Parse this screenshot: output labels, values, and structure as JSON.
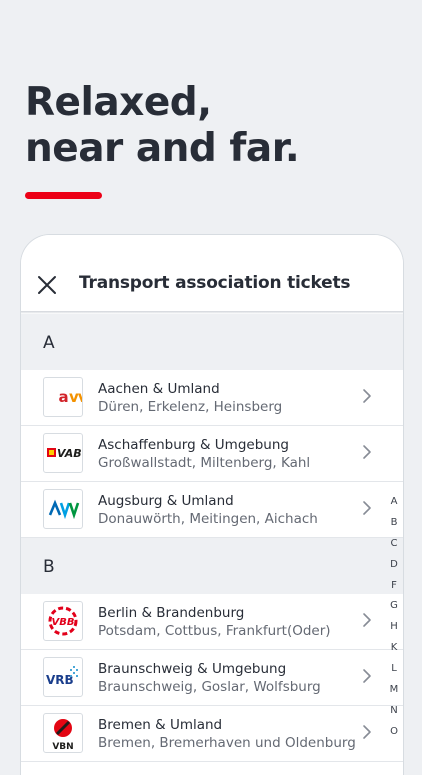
{
  "promo": {
    "headline_line1": "Relaxed,",
    "headline_line2": "near and far.",
    "accent_color": "#ec0016"
  },
  "screen": {
    "title": "Transport association tickets",
    "close_icon": "close-icon"
  },
  "sections": [
    {
      "letter": "A",
      "items": [
        {
          "title": "Aachen & Umland",
          "subtitle": "Düren, Erkelenz, Heinsberg",
          "logo": "AVV"
        },
        {
          "title": "Aschaffenburg & Umgebung",
          "subtitle": "Großwallstadt, Miltenberg, Kahl",
          "logo": "VAB"
        },
        {
          "title": "Augsburg & Umland",
          "subtitle": "Donauwörth, Meitingen, Aichach",
          "logo": "AVV"
        }
      ]
    },
    {
      "letter": "B",
      "items": [
        {
          "title": "Berlin & Brandenburg",
          "subtitle": "Potsdam, Cottbus, Frankfurt(Oder)",
          "logo": "VBB"
        },
        {
          "title": "Braunschweig & Umgebung",
          "subtitle": "Braunschweig, Goslar, Wolfsburg",
          "logo": "VRB"
        },
        {
          "title": "Bremen & Umland",
          "subtitle": "Bremen, Bremerhaven und Oldenburg",
          "logo": "VBN"
        }
      ]
    }
  ],
  "index_letters": [
    "A",
    "B",
    "C",
    "D",
    "F",
    "G",
    "H",
    "K",
    "L",
    "M",
    "N",
    "O"
  ]
}
